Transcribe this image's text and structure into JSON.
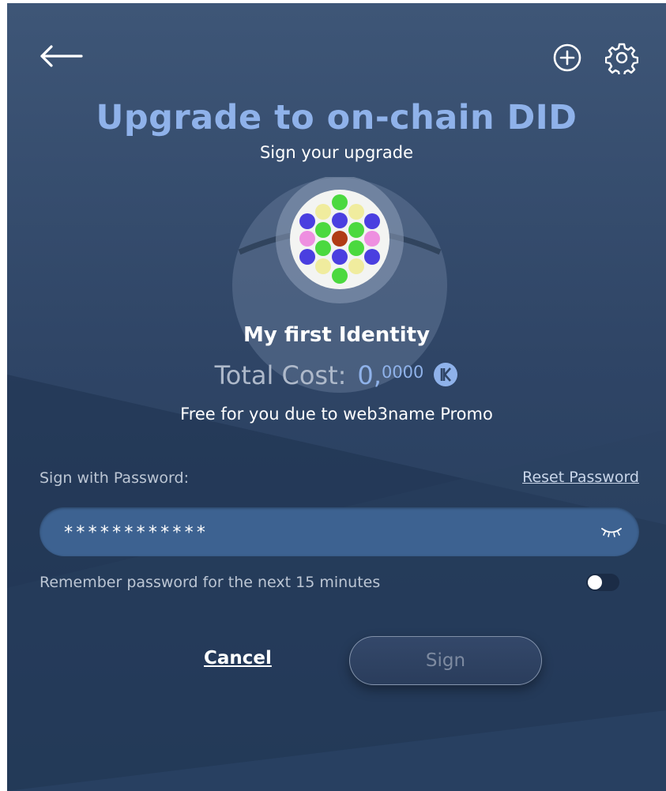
{
  "header": {
    "back_icon": "arrow-left-icon",
    "add_icon": "plus-circle-icon",
    "settings_icon": "gear-icon"
  },
  "title": "Upgrade to on-chain DID",
  "subtitle": "Sign your upgrade",
  "identity": {
    "name": "My first Identity",
    "avatar_icon": "identicon-dots"
  },
  "cost": {
    "label": "Total Cost:",
    "value_int": "0,",
    "value_dec": "0000",
    "currency_icon": "kilt-coin-icon",
    "promo": "Free for you due to web3name Promo"
  },
  "password": {
    "label": "Sign with Password:",
    "reset_link": "Reset Password",
    "value": "************",
    "reveal_icon": "eye-closed-icon"
  },
  "remember": {
    "label": "Remember password for the next 15 minutes",
    "enabled": false
  },
  "actions": {
    "cancel": "Cancel",
    "sign": "Sign"
  },
  "colors": {
    "accent": "#8fb2ea",
    "background": "#2f4566",
    "input_bg": "#3d6291"
  }
}
